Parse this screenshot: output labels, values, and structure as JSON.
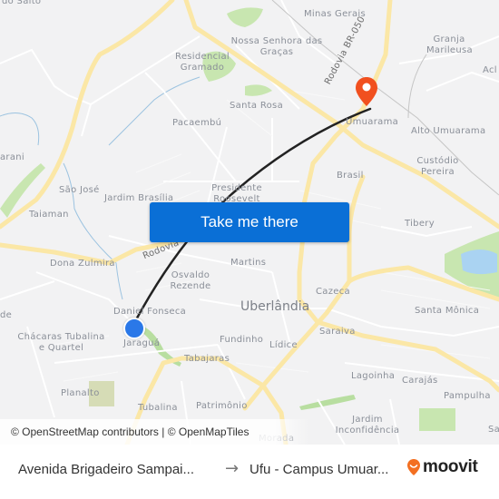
{
  "map": {
    "neighborhoods": [
      {
        "name": "do Salto",
        "pos": "top-left"
      },
      {
        "name": "Minas Gerais"
      },
      {
        "name": "Nossa Senhora das Graças"
      },
      {
        "name": "Residencial Gramado"
      },
      {
        "name": "Granja Marileusa"
      },
      {
        "name": "Acl"
      },
      {
        "name": "Santa Rosa"
      },
      {
        "name": "Pacaembú"
      },
      {
        "name": "Umuarama"
      },
      {
        "name": "Alto Umuarama"
      },
      {
        "name": "arani"
      },
      {
        "name": "Custódio Pereira"
      },
      {
        "name": "Brasil"
      },
      {
        "name": "São José"
      },
      {
        "name": "Jardim Brasília"
      },
      {
        "name": "Presidente Roosevelt"
      },
      {
        "name": "Taiaman"
      },
      {
        "name": "Tibery"
      },
      {
        "name": "Dona Zulmira"
      },
      {
        "name": "Martins"
      },
      {
        "name": "Osvaldo Rezende"
      },
      {
        "name": "Cazeca"
      },
      {
        "name": "Uberlândia"
      },
      {
        "name": "Daniel Fonseca"
      },
      {
        "name": "Santa Mônica"
      },
      {
        "name": "de"
      },
      {
        "name": "Chácaras Tubalina e Quartel"
      },
      {
        "name": "Jaraguá"
      },
      {
        "name": "Fundinho"
      },
      {
        "name": "Lídice"
      },
      {
        "name": "Saraiva"
      },
      {
        "name": "Tabajaras"
      },
      {
        "name": "Lagoinha"
      },
      {
        "name": "Carajás"
      },
      {
        "name": "Planalto"
      },
      {
        "name": "Pampulha"
      },
      {
        "name": "Tubalina"
      },
      {
        "name": "Patrimônio"
      },
      {
        "name": "Jardim Inconfidência"
      },
      {
        "name": "Morada"
      },
      {
        "name": "Sa"
      }
    ],
    "roads": {
      "br050": "Rodovia BR-050",
      "rodovia": "Rodovia"
    },
    "origin_marker": "origin-dot",
    "destination_marker": "destination-pin",
    "colors": {
      "route": "#222222",
      "origin": "#2a78e8",
      "destination": "#f1501f",
      "highway": "#fbe7a6",
      "park": "#c8e6b0",
      "water": "#aad3f2"
    }
  },
  "cta": {
    "label": "Take me there"
  },
  "attribution": "© OpenStreetMap contributors | © OpenMapTiles",
  "footer": {
    "from": "Avenida Brigadeiro Sampai...",
    "arrow": "→",
    "to": "Ufu - Campus Umuar...",
    "brand": "moovit",
    "brand_color": "#f36f21"
  }
}
